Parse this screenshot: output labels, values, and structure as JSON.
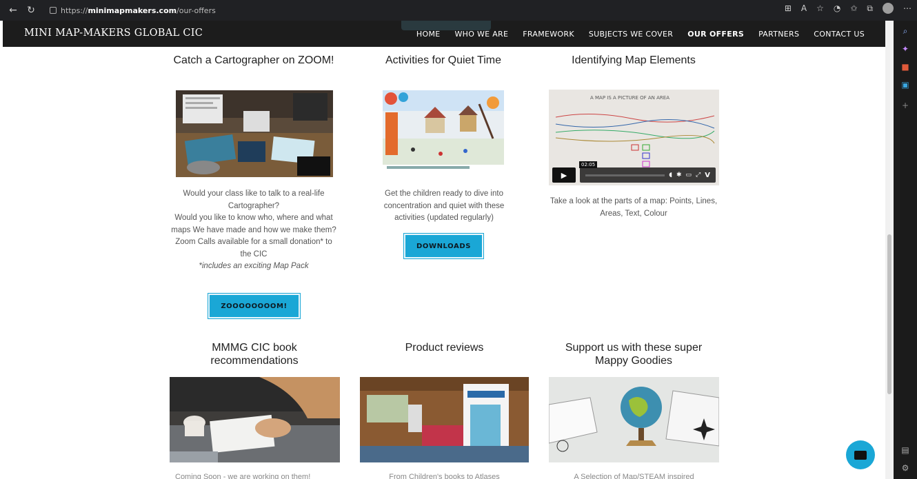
{
  "browser": {
    "url_prefix": "https://",
    "url_domain": "minimapmakers.com",
    "url_path": "/our-offers"
  },
  "site": {
    "brand": "MINI MAP-MAKERS GLOBAL CIC",
    "nav": [
      "HOME",
      "WHO WE ARE",
      "FRAMEWORK",
      "SUBJECTS WE COVER",
      "OUR OFFERS",
      "PARTNERS",
      "CONTACT US"
    ]
  },
  "cards": {
    "zoom": {
      "title": "Catch a Cartographer on ZOOM!",
      "lines": [
        "Would your class like to talk to a real-life Cartographer?",
        "Would you like to know who, where and what maps We have made and how we make them?",
        "Zoom Calls available for a small donation* to the CIC"
      ],
      "note": "*includes an exciting Map Pack",
      "button": "ZOOOOOOOOM!"
    },
    "quiet": {
      "title": "Activities for Quiet Time",
      "text": "Get the children ready to dive into concentration and quiet with these activities (updated regularly)",
      "button": "DOWNLOADS"
    },
    "elements": {
      "title": "Identifying Map Elements",
      "text": "Take a look at the parts of a map: Points, Lines, Areas, Text, Colour",
      "video_time": "02:05"
    },
    "books": {
      "title": "MMMG CIC book recommendations",
      "cut_text": "Coming Soon - we are working on them!"
    },
    "reviews": {
      "title": "Product reviews",
      "cut_text": "From Children's books to Atlases"
    },
    "goodies": {
      "title": "Support us with these super Mappy Goodies",
      "cut_text": "A Selection of Map/STEAM inspired"
    }
  }
}
